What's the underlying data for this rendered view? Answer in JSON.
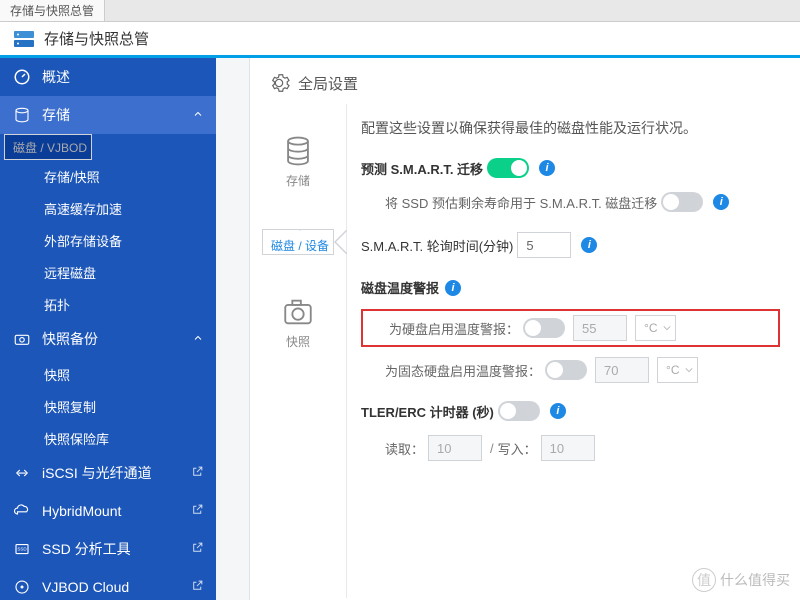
{
  "tab": "存储与快照总管",
  "app": {
    "title": "存储与快照总管"
  },
  "sidebar": {
    "overview": "概述",
    "storage": "存储",
    "items": [
      "磁盘 / VJBOD",
      "存储/快照",
      "高速缓存加速",
      "外部存储设备",
      "远程磁盘",
      "拓扑"
    ],
    "snapshot": "快照备份",
    "snapItems": [
      "快照",
      "快照复制",
      "快照保险库"
    ],
    "iscsi": "iSCSI 与光纤通道",
    "hybrid": "HybridMount",
    "ssd": "SSD 分析工具",
    "vjbod": "VJBOD Cloud"
  },
  "vnav": {
    "storage": "存储",
    "disk": "磁盘 / 设备",
    "snapshot": "快照"
  },
  "crumb": "全局设置",
  "form": {
    "intro": "配置这些设置以确保获得最佳的磁盘性能及运行状况。",
    "smart": "预测 S.M.A.R.T. 迁移",
    "ssdLife": "将 SSD 预估剩余寿命用于 S.M.A.R.T. 磁盘迁移",
    "pollLabel": "S.M.A.R.T. 轮询时间(分钟)",
    "pollVal": "5",
    "tempTitle": "磁盘温度警报",
    "hddTemp": "为硬盘启用温度警报：",
    "ssdTemp": "为固态硬盘启用温度警报：",
    "hddVal": "55",
    "ssdVal": "70",
    "unit": "°C",
    "tler": "TLER/ERC 计时器 (秒)",
    "read": "读取：",
    "write": "写入：",
    "rwVal": "10",
    "slash": "/"
  },
  "watermark": "什么值得买"
}
